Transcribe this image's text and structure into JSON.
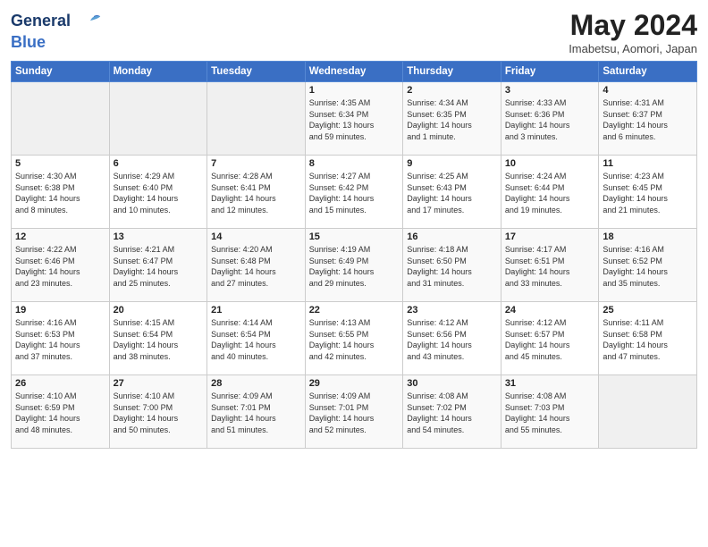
{
  "logo": {
    "line1": "General",
    "line2": "Blue"
  },
  "title": "May 2024",
  "subtitle": "Imabetsu, Aomori, Japan",
  "weekdays": [
    "Sunday",
    "Monday",
    "Tuesday",
    "Wednesday",
    "Thursday",
    "Friday",
    "Saturday"
  ],
  "weeks": [
    [
      {
        "day": "",
        "info": ""
      },
      {
        "day": "",
        "info": ""
      },
      {
        "day": "",
        "info": ""
      },
      {
        "day": "1",
        "info": "Sunrise: 4:35 AM\nSunset: 6:34 PM\nDaylight: 13 hours\nand 59 minutes."
      },
      {
        "day": "2",
        "info": "Sunrise: 4:34 AM\nSunset: 6:35 PM\nDaylight: 14 hours\nand 1 minute."
      },
      {
        "day": "3",
        "info": "Sunrise: 4:33 AM\nSunset: 6:36 PM\nDaylight: 14 hours\nand 3 minutes."
      },
      {
        "day": "4",
        "info": "Sunrise: 4:31 AM\nSunset: 6:37 PM\nDaylight: 14 hours\nand 6 minutes."
      }
    ],
    [
      {
        "day": "5",
        "info": "Sunrise: 4:30 AM\nSunset: 6:38 PM\nDaylight: 14 hours\nand 8 minutes."
      },
      {
        "day": "6",
        "info": "Sunrise: 4:29 AM\nSunset: 6:40 PM\nDaylight: 14 hours\nand 10 minutes."
      },
      {
        "day": "7",
        "info": "Sunrise: 4:28 AM\nSunset: 6:41 PM\nDaylight: 14 hours\nand 12 minutes."
      },
      {
        "day": "8",
        "info": "Sunrise: 4:27 AM\nSunset: 6:42 PM\nDaylight: 14 hours\nand 15 minutes."
      },
      {
        "day": "9",
        "info": "Sunrise: 4:25 AM\nSunset: 6:43 PM\nDaylight: 14 hours\nand 17 minutes."
      },
      {
        "day": "10",
        "info": "Sunrise: 4:24 AM\nSunset: 6:44 PM\nDaylight: 14 hours\nand 19 minutes."
      },
      {
        "day": "11",
        "info": "Sunrise: 4:23 AM\nSunset: 6:45 PM\nDaylight: 14 hours\nand 21 minutes."
      }
    ],
    [
      {
        "day": "12",
        "info": "Sunrise: 4:22 AM\nSunset: 6:46 PM\nDaylight: 14 hours\nand 23 minutes."
      },
      {
        "day": "13",
        "info": "Sunrise: 4:21 AM\nSunset: 6:47 PM\nDaylight: 14 hours\nand 25 minutes."
      },
      {
        "day": "14",
        "info": "Sunrise: 4:20 AM\nSunset: 6:48 PM\nDaylight: 14 hours\nand 27 minutes."
      },
      {
        "day": "15",
        "info": "Sunrise: 4:19 AM\nSunset: 6:49 PM\nDaylight: 14 hours\nand 29 minutes."
      },
      {
        "day": "16",
        "info": "Sunrise: 4:18 AM\nSunset: 6:50 PM\nDaylight: 14 hours\nand 31 minutes."
      },
      {
        "day": "17",
        "info": "Sunrise: 4:17 AM\nSunset: 6:51 PM\nDaylight: 14 hours\nand 33 minutes."
      },
      {
        "day": "18",
        "info": "Sunrise: 4:16 AM\nSunset: 6:52 PM\nDaylight: 14 hours\nand 35 minutes."
      }
    ],
    [
      {
        "day": "19",
        "info": "Sunrise: 4:16 AM\nSunset: 6:53 PM\nDaylight: 14 hours\nand 37 minutes."
      },
      {
        "day": "20",
        "info": "Sunrise: 4:15 AM\nSunset: 6:54 PM\nDaylight: 14 hours\nand 38 minutes."
      },
      {
        "day": "21",
        "info": "Sunrise: 4:14 AM\nSunset: 6:54 PM\nDaylight: 14 hours\nand 40 minutes."
      },
      {
        "day": "22",
        "info": "Sunrise: 4:13 AM\nSunset: 6:55 PM\nDaylight: 14 hours\nand 42 minutes."
      },
      {
        "day": "23",
        "info": "Sunrise: 4:12 AM\nSunset: 6:56 PM\nDaylight: 14 hours\nand 43 minutes."
      },
      {
        "day": "24",
        "info": "Sunrise: 4:12 AM\nSunset: 6:57 PM\nDaylight: 14 hours\nand 45 minutes."
      },
      {
        "day": "25",
        "info": "Sunrise: 4:11 AM\nSunset: 6:58 PM\nDaylight: 14 hours\nand 47 minutes."
      }
    ],
    [
      {
        "day": "26",
        "info": "Sunrise: 4:10 AM\nSunset: 6:59 PM\nDaylight: 14 hours\nand 48 minutes."
      },
      {
        "day": "27",
        "info": "Sunrise: 4:10 AM\nSunset: 7:00 PM\nDaylight: 14 hours\nand 50 minutes."
      },
      {
        "day": "28",
        "info": "Sunrise: 4:09 AM\nSunset: 7:01 PM\nDaylight: 14 hours\nand 51 minutes."
      },
      {
        "day": "29",
        "info": "Sunrise: 4:09 AM\nSunset: 7:01 PM\nDaylight: 14 hours\nand 52 minutes."
      },
      {
        "day": "30",
        "info": "Sunrise: 4:08 AM\nSunset: 7:02 PM\nDaylight: 14 hours\nand 54 minutes."
      },
      {
        "day": "31",
        "info": "Sunrise: 4:08 AM\nSunset: 7:03 PM\nDaylight: 14 hours\nand 55 minutes."
      },
      {
        "day": "",
        "info": ""
      }
    ]
  ]
}
